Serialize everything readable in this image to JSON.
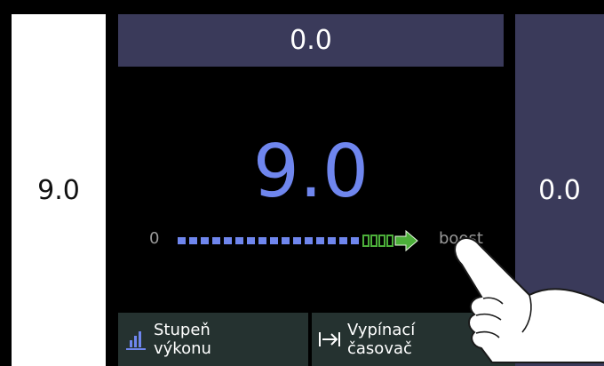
{
  "zones": {
    "left_value": "9.0",
    "top_value": "0.0",
    "right_value": "0.0"
  },
  "main": {
    "power_value": "9.0",
    "scale_min": "0",
    "scale_max": "boost",
    "level_fraction": 0.82
  },
  "buttons": {
    "power_level_label": "Stupeň\nvýkonu",
    "timer_label": "Vypínací\nčasovač"
  },
  "icons": {
    "power_level": "bar-chart-icon",
    "timer": "timer-arrow-icon",
    "boost_arrow": "boost-arrow-icon"
  },
  "colors": {
    "accent": "#6f86ee",
    "boost": "#4caf3a",
    "zone_bg": "#3a3a5a",
    "button_bg": "#253230"
  }
}
